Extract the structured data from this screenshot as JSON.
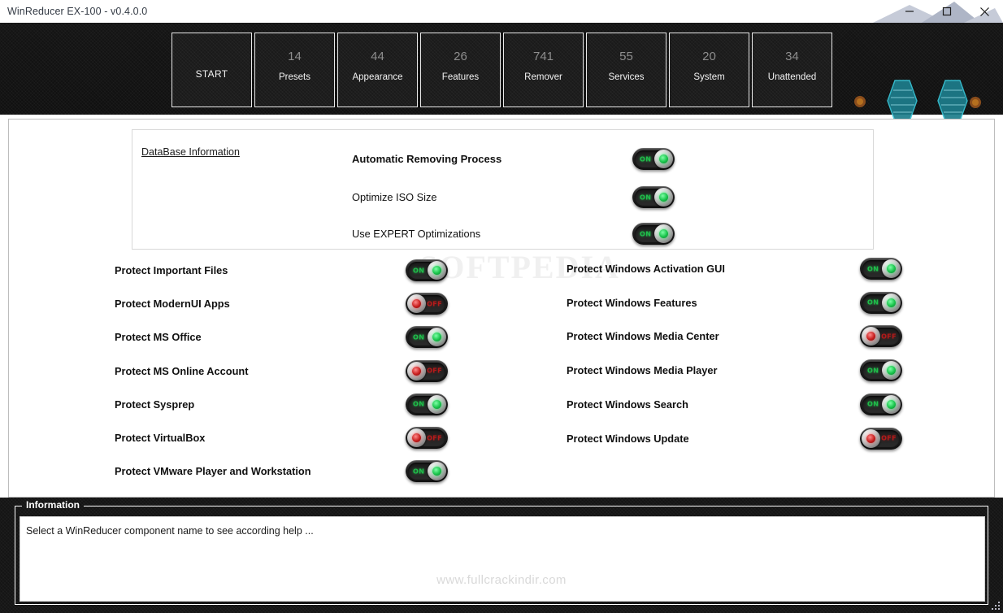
{
  "window": {
    "title": "WinReducer EX-100 - v0.4.0.0",
    "minimize_label": "minimize",
    "maximize_label": "maximize",
    "close_label": "close"
  },
  "tabs": [
    {
      "count": "",
      "label": "START",
      "active": false
    },
    {
      "count": "14",
      "label": "Presets",
      "active": true
    },
    {
      "count": "44",
      "label": "Appearance",
      "active": false
    },
    {
      "count": "26",
      "label": "Features",
      "active": false
    },
    {
      "count": "741",
      "label": "Remover",
      "active": false
    },
    {
      "count": "55",
      "label": "Services",
      "active": false
    },
    {
      "count": "20",
      "label": "System",
      "active": false
    },
    {
      "count": "34",
      "label": "Unattended",
      "active": false
    }
  ],
  "database_panel": {
    "link_label": "DataBase Information",
    "rows": [
      {
        "label": "Automatic Removing Process",
        "state": "ON",
        "bold": true
      },
      {
        "label": "Optimize ISO Size",
        "state": "ON",
        "bold": false
      },
      {
        "label": "Use EXPERT Optimizations",
        "state": "ON",
        "bold": false
      }
    ]
  },
  "protect_left": [
    {
      "label": "Protect Important Files",
      "state": "ON"
    },
    {
      "label": "Protect ModernUI Apps",
      "state": "OFF"
    },
    {
      "label": "Protect MS Office",
      "state": "ON"
    },
    {
      "label": "Protect MS Online Account",
      "state": "OFF"
    },
    {
      "label": "Protect Sysprep",
      "state": "ON"
    },
    {
      "label": "Protect VirtualBox",
      "state": "OFF"
    },
    {
      "label": "Protect VMware Player and Workstation",
      "state": "ON"
    }
  ],
  "protect_right": [
    {
      "label": "Protect Windows Activation GUI",
      "state": "ON"
    },
    {
      "label": "Protect Windows Features",
      "state": "ON"
    },
    {
      "label": "Protect Windows Media Center",
      "state": "OFF"
    },
    {
      "label": "Protect Windows Media Player",
      "state": "ON"
    },
    {
      "label": "Protect Windows Search",
      "state": "ON"
    },
    {
      "label": "Protect Windows Update",
      "state": "OFF"
    }
  ],
  "information": {
    "legend": "Information",
    "text": "Select a WinReducer component name to see according help ..."
  },
  "watermarks": {
    "top": "SOFTPEDIA",
    "bottom": "www.fullcrackindir.com"
  },
  "colors": {
    "header_bg": "#141414",
    "accent_on": "#19c44b",
    "accent_off": "#c81f1f",
    "logo_hex": "#1b7f8c",
    "logo_dot": "#9a5a22",
    "panel_bg": "#ffffff"
  }
}
